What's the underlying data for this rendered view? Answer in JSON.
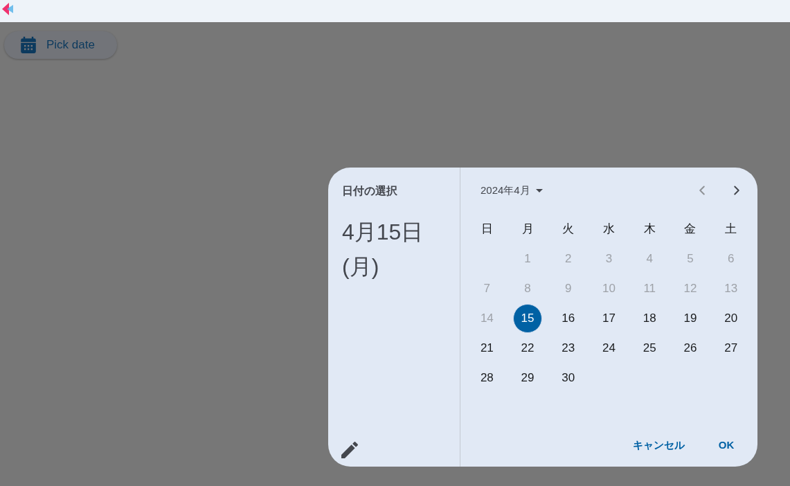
{
  "pick_date_button": {
    "label": "Pick date"
  },
  "date_picker": {
    "title": "日付の選択",
    "headline": "4月15日(月)",
    "month_label": "2024年4月",
    "previous_month": {
      "disabled": true
    },
    "next_month": {
      "disabled": false
    },
    "weekdays": [
      "日",
      "月",
      "火",
      "水",
      "木",
      "金",
      "土"
    ],
    "weeks": [
      {
        "days": [
          {
            "kind": "empty"
          },
          {
            "kind": "day",
            "label": "1",
            "disabled": true,
            "selected": false,
            "today": false
          },
          {
            "kind": "day",
            "label": "2",
            "disabled": true,
            "selected": false,
            "today": false
          },
          {
            "kind": "day",
            "label": "3",
            "disabled": true,
            "selected": false,
            "today": false
          },
          {
            "kind": "day",
            "label": "4",
            "disabled": true,
            "selected": false,
            "today": false
          },
          {
            "kind": "day",
            "label": "5",
            "disabled": true,
            "selected": false,
            "today": false
          },
          {
            "kind": "day",
            "label": "6",
            "disabled": true,
            "selected": false,
            "today": false
          }
        ]
      },
      {
        "days": [
          {
            "kind": "day",
            "label": "7",
            "disabled": true,
            "selected": false,
            "today": false
          },
          {
            "kind": "day",
            "label": "8",
            "disabled": true,
            "selected": false,
            "today": false
          },
          {
            "kind": "day",
            "label": "9",
            "disabled": true,
            "selected": false,
            "today": false
          },
          {
            "kind": "day",
            "label": "10",
            "disabled": true,
            "selected": false,
            "today": false
          },
          {
            "kind": "day",
            "label": "11",
            "disabled": true,
            "selected": false,
            "today": false
          },
          {
            "kind": "day",
            "label": "12",
            "disabled": true,
            "selected": false,
            "today": false
          },
          {
            "kind": "day",
            "label": "13",
            "disabled": true,
            "selected": false,
            "today": false
          }
        ]
      },
      {
        "days": [
          {
            "kind": "day",
            "label": "14",
            "disabled": true,
            "selected": false,
            "today": false
          },
          {
            "kind": "day",
            "label": "15",
            "disabled": false,
            "selected": true,
            "today": true
          },
          {
            "kind": "day",
            "label": "16",
            "disabled": false,
            "selected": false,
            "today": false
          },
          {
            "kind": "day",
            "label": "17",
            "disabled": false,
            "selected": false,
            "today": false
          },
          {
            "kind": "day",
            "label": "18",
            "disabled": false,
            "selected": false,
            "today": false
          },
          {
            "kind": "day",
            "label": "19",
            "disabled": false,
            "selected": false,
            "today": false
          },
          {
            "kind": "day",
            "label": "20",
            "disabled": false,
            "selected": false,
            "today": false
          }
        ]
      },
      {
        "days": [
          {
            "kind": "day",
            "label": "21",
            "disabled": false,
            "selected": false,
            "today": false
          },
          {
            "kind": "day",
            "label": "22",
            "disabled": false,
            "selected": false,
            "today": false
          },
          {
            "kind": "day",
            "label": "23",
            "disabled": false,
            "selected": false,
            "today": false
          },
          {
            "kind": "day",
            "label": "24",
            "disabled": false,
            "selected": false,
            "today": false
          },
          {
            "kind": "day",
            "label": "25",
            "disabled": false,
            "selected": false,
            "today": false
          },
          {
            "kind": "day",
            "label": "26",
            "disabled": false,
            "selected": false,
            "today": false
          },
          {
            "kind": "day",
            "label": "27",
            "disabled": false,
            "selected": false,
            "today": false
          }
        ]
      },
      {
        "days": [
          {
            "kind": "day",
            "label": "28",
            "disabled": false,
            "selected": false,
            "today": false
          },
          {
            "kind": "day",
            "label": "29",
            "disabled": false,
            "selected": false,
            "today": false
          },
          {
            "kind": "day",
            "label": "30",
            "disabled": false,
            "selected": false,
            "today": false
          }
        ]
      }
    ],
    "actions": [
      {
        "label": "キャンセル"
      },
      {
        "label": "OK"
      }
    ]
  }
}
